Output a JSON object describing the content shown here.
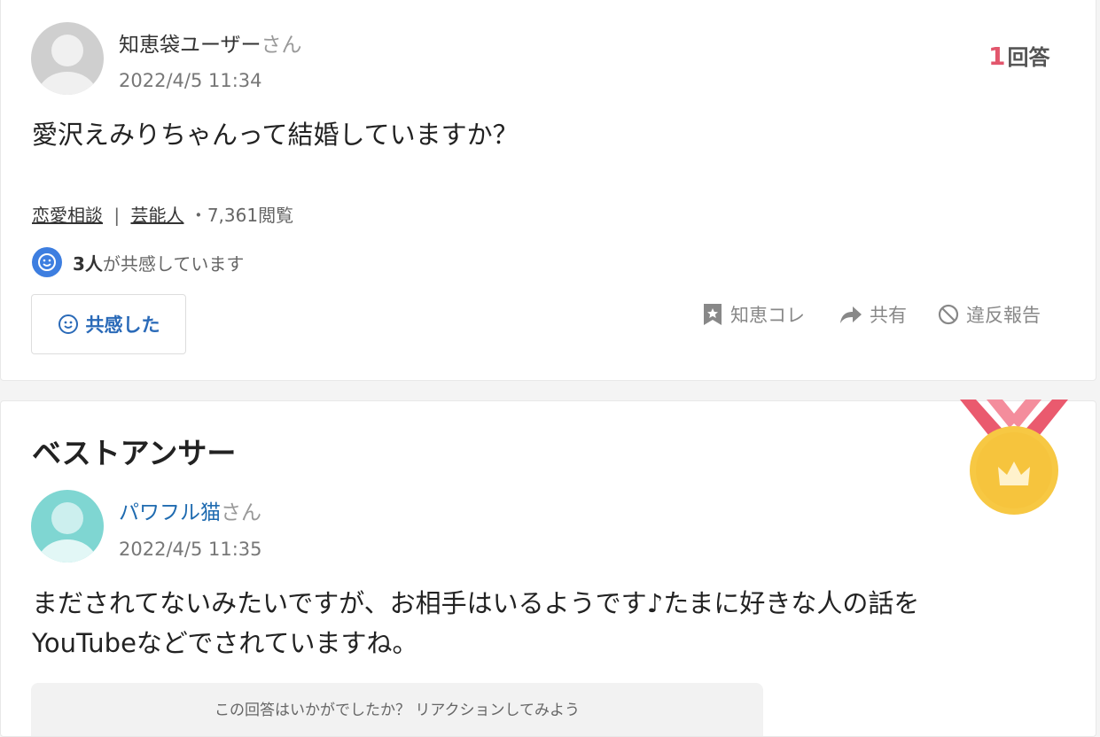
{
  "question": {
    "user_name": "知恵袋ユーザー",
    "user_suffix": "さん",
    "timestamp": "2022/4/5 11:34",
    "answer_count_num": "1",
    "answer_count_label": "回答",
    "body": "愛沢えみりちゃんって結婚していますか？",
    "categories": [
      "恋愛相談",
      "芸能人"
    ],
    "category_separator": "|",
    "views": "・7,361閲覧",
    "empathy_count": "3人",
    "empathy_text": "が共感しています",
    "empathy_button_label": "共感した",
    "actions": {
      "bookmark_label": "知恵コレ",
      "share_label": "共有",
      "report_label": "違反報告"
    }
  },
  "best_answer": {
    "section_title": "ベストアンサー",
    "user_name": "パワフル猫",
    "user_suffix": "さん",
    "timestamp": "2022/4/5 11:35",
    "body_line1": "まだされてないみたいですが、お相手はいるようです♪たまに好きな人の話を",
    "body_line2": "YouTubeなどでされていますね。",
    "reaction_prompt": "この回答はいかがでしたか？ リアクションしてみよう"
  },
  "colors": {
    "accent_blue": "#2a6ab8",
    "link_blue": "#1f6bb0",
    "answer_count_red": "#e2566c",
    "medal_gold": "#f7c843",
    "ribbon_red": "#ea5a6e"
  },
  "icons": {
    "empathy": "smile-icon",
    "bookmark": "bookmark-star-icon",
    "share": "share-arrow-icon",
    "report": "prohibit-icon",
    "medal": "crown-medal-icon"
  }
}
